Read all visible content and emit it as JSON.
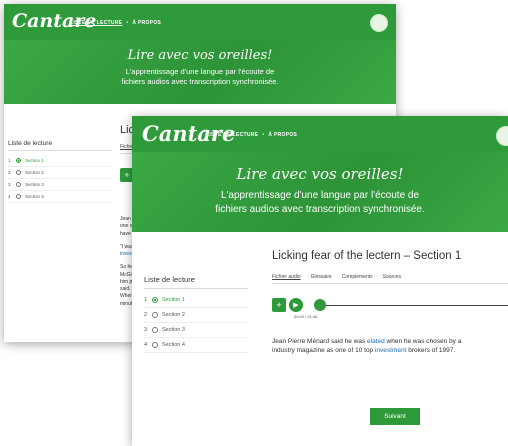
{
  "brand": {
    "logo_text": "Cantare"
  },
  "nav": {
    "items": [
      "LISTE DE LECTURE",
      "À PROPOS"
    ],
    "separator": "•"
  },
  "hero": {
    "title": "Lire avec vos oreilles!",
    "subtitle_line1": "L'apprentissage d'une langue par l'écoute de",
    "subtitle_line2": "fichiers audios avec transcription synchronisée."
  },
  "playlist": {
    "title": "Liste de lecture",
    "items": [
      {
        "num": "1",
        "label": "Section 1",
        "active": true
      },
      {
        "num": "2",
        "label": "Section 2",
        "active": false
      },
      {
        "num": "3",
        "label": "Section 3",
        "active": false
      },
      {
        "num": "4",
        "label": "Section 4",
        "active": false
      }
    ]
  },
  "content": {
    "title": "Licking fear of the lectern – Section 1",
    "back_title": "Licki",
    "tabs": [
      "Fichier audio",
      "Glossaire",
      "Compléments",
      "Sources"
    ],
    "back_tab": "Fichier a",
    "player": {
      "plus": "+",
      "play": "▶",
      "time": "00:00 / 01:46",
      "progress": 0
    },
    "paragraph_pre": "Jean Pierre Ménard said he was ",
    "word1": "elated",
    "paragraph_mid": " when he was chosen by a",
    "paragraph_line2_pre": "industry magazine as one of 10 top ",
    "word2": "investment",
    "paragraph_line2_post": " brokers of 1997.",
    "back_fragments": [
      [
        "Jean P",
        "one of",
        "have t"
      ],
      [
        "\"I was",
        "invest"
      ],
      [
        "So he",
        "McGill",
        "him p",
        "said. \"",
        "When",
        "minut"
      ]
    ],
    "next_button": "Suivant"
  },
  "colors": {
    "brand_green": "#2f9a3a",
    "link_blue": "#1a6fb5"
  }
}
